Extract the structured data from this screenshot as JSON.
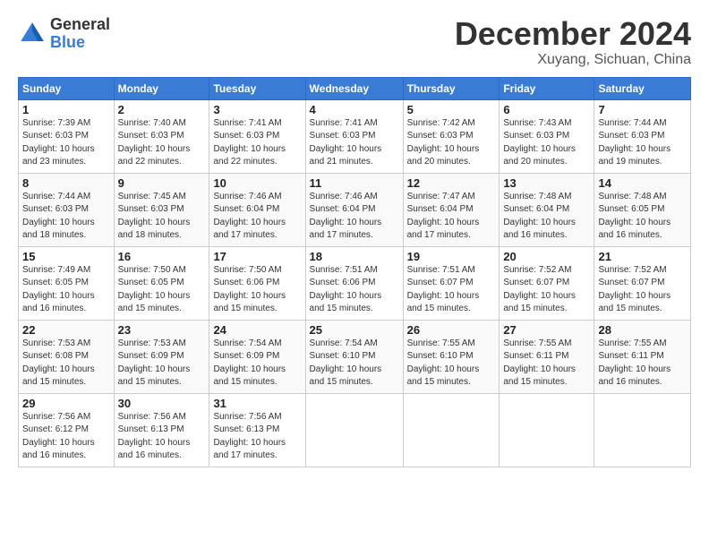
{
  "header": {
    "logo_general": "General",
    "logo_blue": "Blue",
    "month_title": "December 2024",
    "location": "Xuyang, Sichuan, China"
  },
  "calendar": {
    "headers": [
      "Sunday",
      "Monday",
      "Tuesday",
      "Wednesday",
      "Thursday",
      "Friday",
      "Saturday"
    ],
    "weeks": [
      [
        null,
        null,
        null,
        null,
        null,
        null,
        null
      ]
    ]
  },
  "days": {
    "w1": [
      {
        "num": "1",
        "rise": "7:39 AM",
        "set": "6:03 PM",
        "dl": "10 hours and 23 minutes."
      },
      {
        "num": "2",
        "rise": "7:40 AM",
        "set": "6:03 PM",
        "dl": "10 hours and 22 minutes."
      },
      {
        "num": "3",
        "rise": "7:41 AM",
        "set": "6:03 PM",
        "dl": "10 hours and 22 minutes."
      },
      {
        "num": "4",
        "rise": "7:41 AM",
        "set": "6:03 PM",
        "dl": "10 hours and 21 minutes."
      },
      {
        "num": "5",
        "rise": "7:42 AM",
        "set": "6:03 PM",
        "dl": "10 hours and 20 minutes."
      },
      {
        "num": "6",
        "rise": "7:43 AM",
        "set": "6:03 PM",
        "dl": "10 hours and 20 minutes."
      },
      {
        "num": "7",
        "rise": "7:44 AM",
        "set": "6:03 PM",
        "dl": "10 hours and 19 minutes."
      }
    ],
    "w2": [
      {
        "num": "8",
        "rise": "7:44 AM",
        "set": "6:03 PM",
        "dl": "10 hours and 18 minutes."
      },
      {
        "num": "9",
        "rise": "7:45 AM",
        "set": "6:03 PM",
        "dl": "10 hours and 18 minutes."
      },
      {
        "num": "10",
        "rise": "7:46 AM",
        "set": "6:04 PM",
        "dl": "10 hours and 17 minutes."
      },
      {
        "num": "11",
        "rise": "7:46 AM",
        "set": "6:04 PM",
        "dl": "10 hours and 17 minutes."
      },
      {
        "num": "12",
        "rise": "7:47 AM",
        "set": "6:04 PM",
        "dl": "10 hours and 17 minutes."
      },
      {
        "num": "13",
        "rise": "7:48 AM",
        "set": "6:04 PM",
        "dl": "10 hours and 16 minutes."
      },
      {
        "num": "14",
        "rise": "7:48 AM",
        "set": "6:05 PM",
        "dl": "10 hours and 16 minutes."
      }
    ],
    "w3": [
      {
        "num": "15",
        "rise": "7:49 AM",
        "set": "6:05 PM",
        "dl": "10 hours and 16 minutes."
      },
      {
        "num": "16",
        "rise": "7:50 AM",
        "set": "6:05 PM",
        "dl": "10 hours and 15 minutes."
      },
      {
        "num": "17",
        "rise": "7:50 AM",
        "set": "6:06 PM",
        "dl": "10 hours and 15 minutes."
      },
      {
        "num": "18",
        "rise": "7:51 AM",
        "set": "6:06 PM",
        "dl": "10 hours and 15 minutes."
      },
      {
        "num": "19",
        "rise": "7:51 AM",
        "set": "6:07 PM",
        "dl": "10 hours and 15 minutes."
      },
      {
        "num": "20",
        "rise": "7:52 AM",
        "set": "6:07 PM",
        "dl": "10 hours and 15 minutes."
      },
      {
        "num": "21",
        "rise": "7:52 AM",
        "set": "6:07 PM",
        "dl": "10 hours and 15 minutes."
      }
    ],
    "w4": [
      {
        "num": "22",
        "rise": "7:53 AM",
        "set": "6:08 PM",
        "dl": "10 hours and 15 minutes."
      },
      {
        "num": "23",
        "rise": "7:53 AM",
        "set": "6:09 PM",
        "dl": "10 hours and 15 minutes."
      },
      {
        "num": "24",
        "rise": "7:54 AM",
        "set": "6:09 PM",
        "dl": "10 hours and 15 minutes."
      },
      {
        "num": "25",
        "rise": "7:54 AM",
        "set": "6:10 PM",
        "dl": "10 hours and 15 minutes."
      },
      {
        "num": "26",
        "rise": "7:55 AM",
        "set": "6:10 PM",
        "dl": "10 hours and 15 minutes."
      },
      {
        "num": "27",
        "rise": "7:55 AM",
        "set": "6:11 PM",
        "dl": "10 hours and 15 minutes."
      },
      {
        "num": "28",
        "rise": "7:55 AM",
        "set": "6:11 PM",
        "dl": "10 hours and 16 minutes."
      }
    ],
    "w5": [
      {
        "num": "29",
        "rise": "7:56 AM",
        "set": "6:12 PM",
        "dl": "10 hours and 16 minutes."
      },
      {
        "num": "30",
        "rise": "7:56 AM",
        "set": "6:13 PM",
        "dl": "10 hours and 16 minutes."
      },
      {
        "num": "31",
        "rise": "7:56 AM",
        "set": "6:13 PM",
        "dl": "10 hours and 17 minutes."
      }
    ]
  },
  "labels": {
    "sunrise": "Sunrise:",
    "sunset": "Sunset:",
    "daylight": "Daylight: 10 hours"
  }
}
